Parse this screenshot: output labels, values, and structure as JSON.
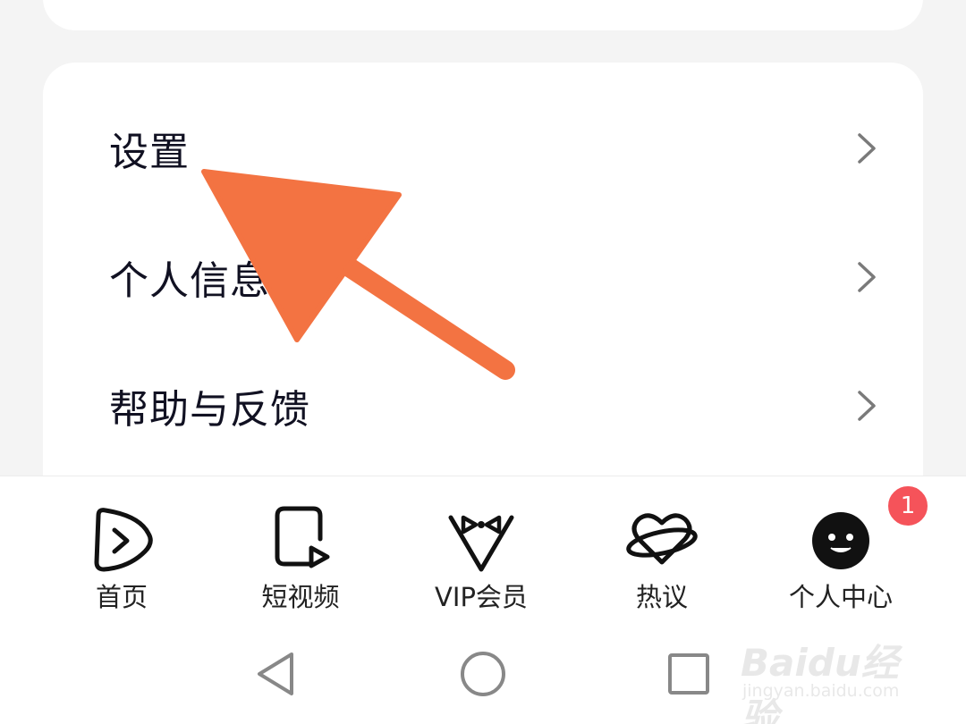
{
  "menu": {
    "items": [
      {
        "label": "设置"
      },
      {
        "label": "个人信息"
      },
      {
        "label": "帮助与反馈"
      }
    ]
  },
  "tabbar": {
    "tabs": [
      {
        "label": "首页",
        "icon": "play-circle-icon"
      },
      {
        "label": "短视频",
        "icon": "short-video-icon"
      },
      {
        "label": "VIP会员",
        "icon": "tuxedo-bowtie-icon"
      },
      {
        "label": "热议",
        "icon": "heart-planet-icon"
      },
      {
        "label": "个人中心",
        "icon": "smiley-face-icon",
        "badge": "1",
        "active": true
      }
    ]
  },
  "system_nav": {
    "buttons": [
      "back-triangle-icon",
      "home-circle-icon",
      "recents-square-icon"
    ]
  },
  "watermark": {
    "main": "Baidu经验",
    "sub": "jingyan.baidu.com"
  },
  "annotation": {
    "arrow_color": "#f37342"
  },
  "colors": {
    "badge": "#f5535a",
    "text_primary": "#111122",
    "chevron": "#7a7a7a"
  }
}
